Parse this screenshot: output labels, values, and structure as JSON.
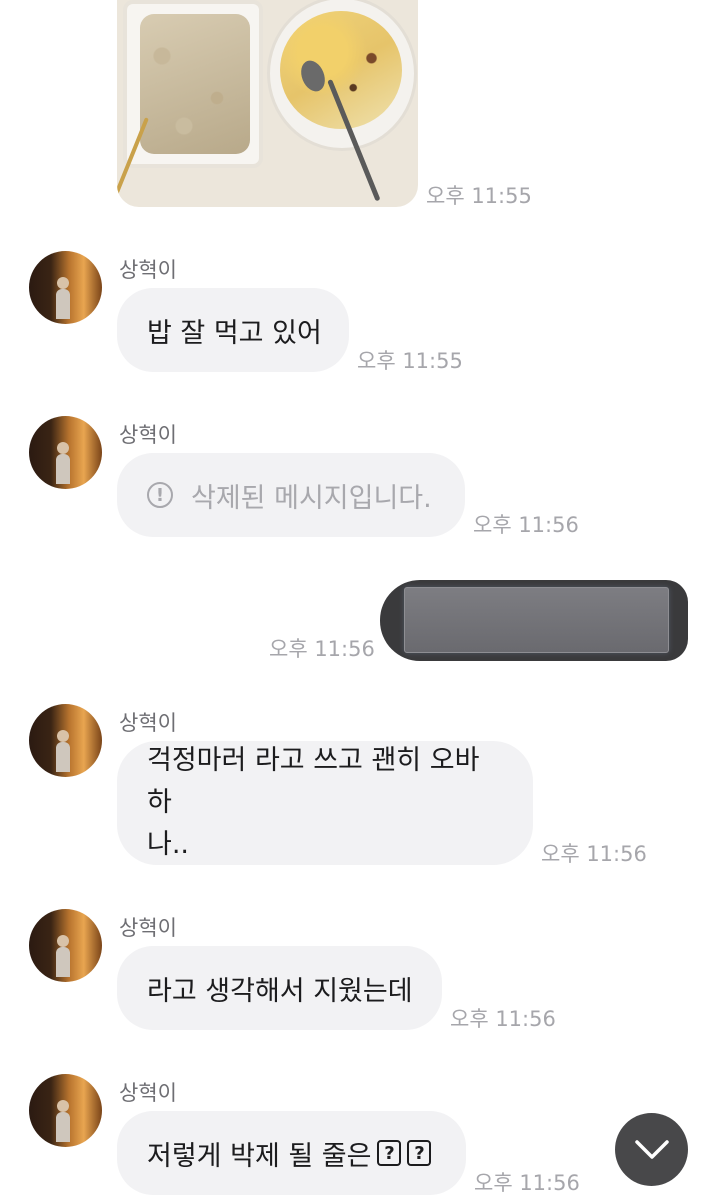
{
  "messages": [
    {
      "type": "image",
      "time": "오후 11:55"
    },
    {
      "sender": "상혁이",
      "text": "밥 잘 먹고 있어",
      "time": "오후 11:55"
    },
    {
      "sender": "상혁이",
      "text": "삭제된 메시지입니다.",
      "time": "오후 11:56",
      "deleted": true
    },
    {
      "type": "sent-redacted",
      "time": "오후 11:56"
    },
    {
      "sender": "상혁이",
      "line1": "걱정마러 라고 쓰고 괜히 오바하",
      "line2": "나..",
      "time": "오후 11:56"
    },
    {
      "sender": "상혁이",
      "text": "라고 생각해서 지웠는데",
      "time": "오후 11:56"
    },
    {
      "sender": "상혁이",
      "text": "저렇게 박제 될 줄은",
      "q1": "?",
      "q2": "?",
      "time": "오후 11:56"
    }
  ],
  "icons": {
    "alert": "!",
    "scroll_down": "chevron-down-icon"
  },
  "colors": {
    "bubble_received": "#f2f2f4",
    "bubble_sent": "#3a3a3c",
    "timestamp": "#a6a6ab",
    "scroll_button": "#48484a"
  }
}
